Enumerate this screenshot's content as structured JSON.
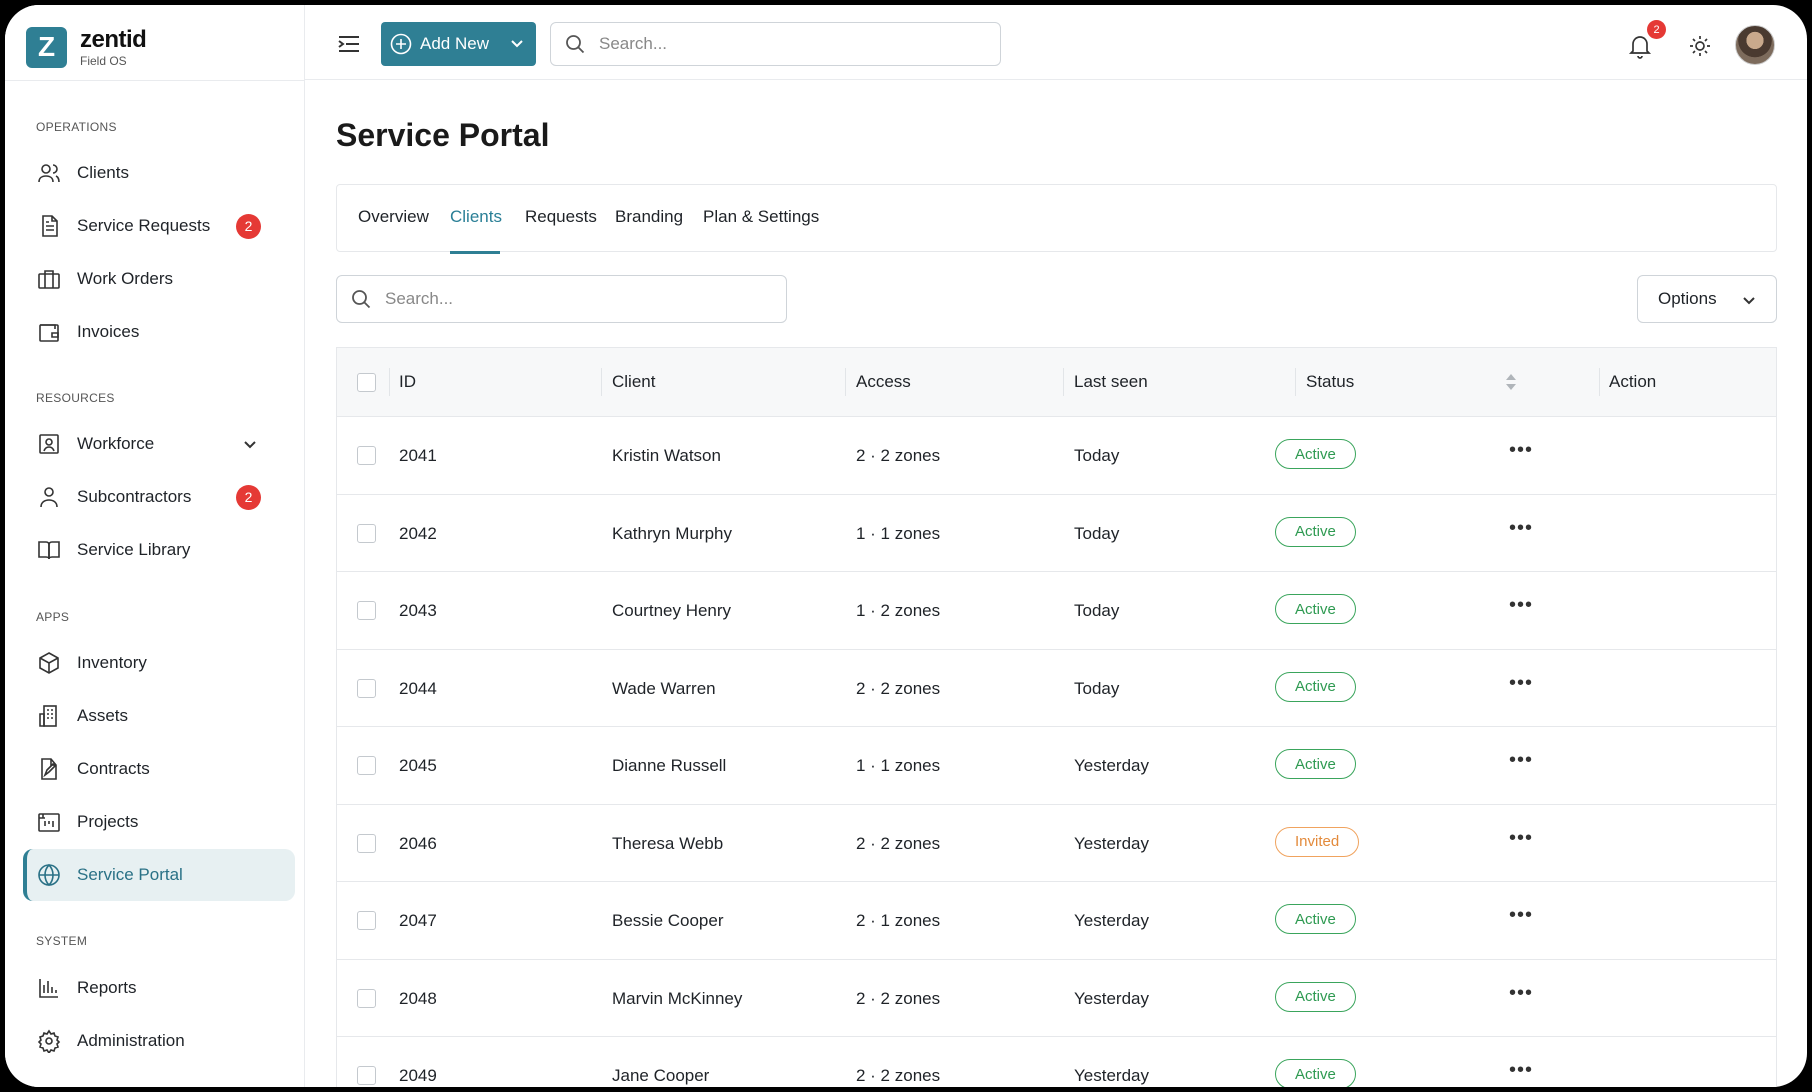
{
  "brand": {
    "letter": "Z",
    "name": "zentid",
    "sub": "Field OS"
  },
  "sidebar": {
    "sections": [
      {
        "label": "OPERATIONS"
      },
      {
        "label": "RESOURCES"
      },
      {
        "label": "APPS"
      },
      {
        "label": "SYSTEM"
      }
    ],
    "items": [
      {
        "label": "Clients",
        "icon": "users-icon"
      },
      {
        "label": "Service Requests",
        "icon": "document-icon",
        "badge": "2"
      },
      {
        "label": "Work Orders",
        "icon": "briefcase-icon"
      },
      {
        "label": "Invoices",
        "icon": "wallet-icon"
      },
      {
        "label": "Workforce",
        "icon": "id-badge-icon"
      },
      {
        "label": "Subcontractors",
        "icon": "user-icon",
        "badge": "2"
      },
      {
        "label": "Service Library",
        "icon": "book-icon"
      },
      {
        "label": "Inventory",
        "icon": "box-icon"
      },
      {
        "label": "Assets",
        "icon": "building-icon"
      },
      {
        "label": "Contracts",
        "icon": "contract-edit-icon"
      },
      {
        "label": "Projects",
        "icon": "kanban-icon"
      },
      {
        "label": "Service Portal",
        "icon": "globe-icon"
      },
      {
        "label": "Reports",
        "icon": "bar-chart-icon"
      },
      {
        "label": "Administration",
        "icon": "gear-icon"
      }
    ]
  },
  "topbar": {
    "add_new_label": "Add New",
    "search_placeholder": "Search...",
    "notification_count": "2"
  },
  "main": {
    "title": "Service Portal",
    "tabs": [
      "Overview",
      "Clients",
      "Requests",
      "Branding",
      "Plan & Settings"
    ],
    "active_tab": "Clients",
    "search_placeholder": "Search...",
    "options_label": "Options"
  },
  "table": {
    "columns": [
      "ID",
      "Client",
      "Access",
      "Last seen",
      "Status",
      "Action"
    ],
    "rows": [
      {
        "id": "2041",
        "client": "Kristin Watson",
        "access": "2 · 2 zones",
        "last_seen": "Today",
        "status": "Active"
      },
      {
        "id": "2042",
        "client": "Kathryn Murphy",
        "access": "1 · 1 zones",
        "last_seen": "Today",
        "status": "Active"
      },
      {
        "id": "2043",
        "client": "Courtney Henry",
        "access": "1 · 2 zones",
        "last_seen": "Today",
        "status": "Active"
      },
      {
        "id": "2044",
        "client": "Wade Warren",
        "access": "2 · 2 zones",
        "last_seen": "Today",
        "status": "Active"
      },
      {
        "id": "2045",
        "client": "Dianne Russell",
        "access": "1 · 1 zones",
        "last_seen": "Yesterday",
        "status": "Active"
      },
      {
        "id": "2046",
        "client": "Theresa Webb",
        "access": "2 · 2 zones",
        "last_seen": "Yesterday",
        "status": "Invited"
      },
      {
        "id": "2047",
        "client": "Bessie Cooper",
        "access": "2 · 1 zones",
        "last_seen": "Yesterday",
        "status": "Active"
      },
      {
        "id": "2048",
        "client": "Marvin McKinney",
        "access": "2 · 2 zones",
        "last_seen": "Yesterday",
        "status": "Active"
      },
      {
        "id": "2049",
        "client": "Jane Cooper",
        "access": "2 · 2 zones",
        "last_seen": "Yesterday",
        "status": "Active"
      }
    ],
    "action_glyph": "•••"
  },
  "colors": {
    "brand": "#2f7f94",
    "active_status": "#2e9a51",
    "invited_status": "#e38a3b",
    "badge": "#e53935"
  }
}
